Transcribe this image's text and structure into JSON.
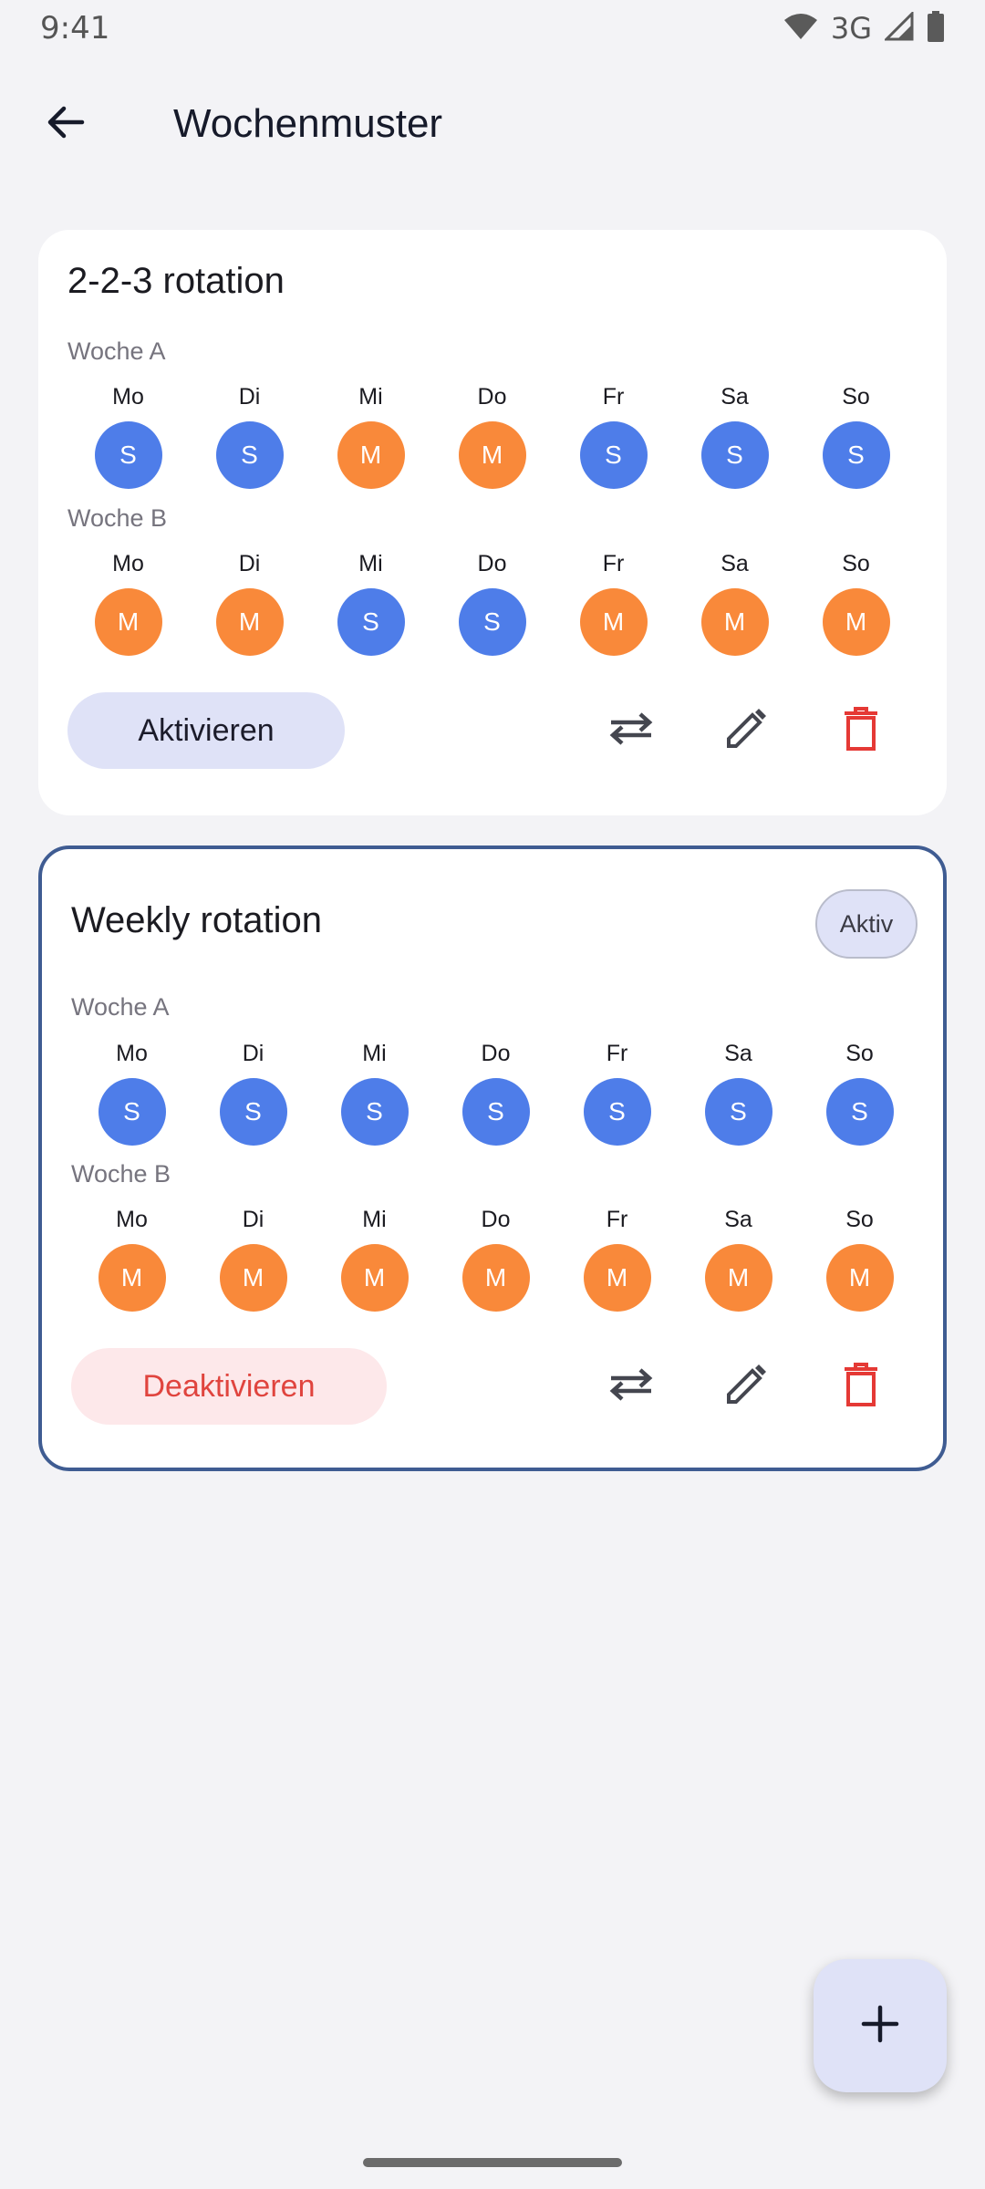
{
  "status_bar": {
    "time": "9:41",
    "network": "3G",
    "icons": [
      "wifi-icon",
      "cell-signal-icon",
      "battery-icon"
    ]
  },
  "header": {
    "title": "Wochenmuster",
    "back_icon": "arrow-back-icon"
  },
  "colors": {
    "S": "#4e7de9",
    "M": "#f9893a",
    "active_border": "#3f5c92",
    "delete": "#e53935"
  },
  "patterns": [
    {
      "name": "2-2-3 rotation",
      "active": false,
      "badge": "",
      "weeks": [
        {
          "label": "Woche A",
          "days": [
            "Mo",
            "Di",
            "Mi",
            "Do",
            "Fr",
            "Sa",
            "So"
          ],
          "shifts": [
            "S",
            "S",
            "M",
            "M",
            "S",
            "S",
            "S"
          ]
        },
        {
          "label": "Woche B",
          "days": [
            "Mo",
            "Di",
            "Mi",
            "Do",
            "Fr",
            "Sa",
            "So"
          ],
          "shifts": [
            "M",
            "M",
            "S",
            "S",
            "M",
            "M",
            "M"
          ]
        }
      ],
      "action_label": "Aktivieren"
    },
    {
      "name": "Weekly rotation",
      "active": true,
      "badge": "Aktiv",
      "weeks": [
        {
          "label": "Woche A",
          "days": [
            "Mo",
            "Di",
            "Mi",
            "Do",
            "Fr",
            "Sa",
            "So"
          ],
          "shifts": [
            "S",
            "S",
            "S",
            "S",
            "S",
            "S",
            "S"
          ]
        },
        {
          "label": "Woche B",
          "days": [
            "Mo",
            "Di",
            "Mi",
            "Do",
            "Fr",
            "Sa",
            "So"
          ],
          "shifts": [
            "M",
            "M",
            "M",
            "M",
            "M",
            "M",
            "M"
          ]
        }
      ],
      "action_label": "Deaktivieren"
    }
  ],
  "card_actions": [
    "swap-icon",
    "edit-icon",
    "delete-icon"
  ],
  "fab": {
    "icon": "add-icon"
  }
}
